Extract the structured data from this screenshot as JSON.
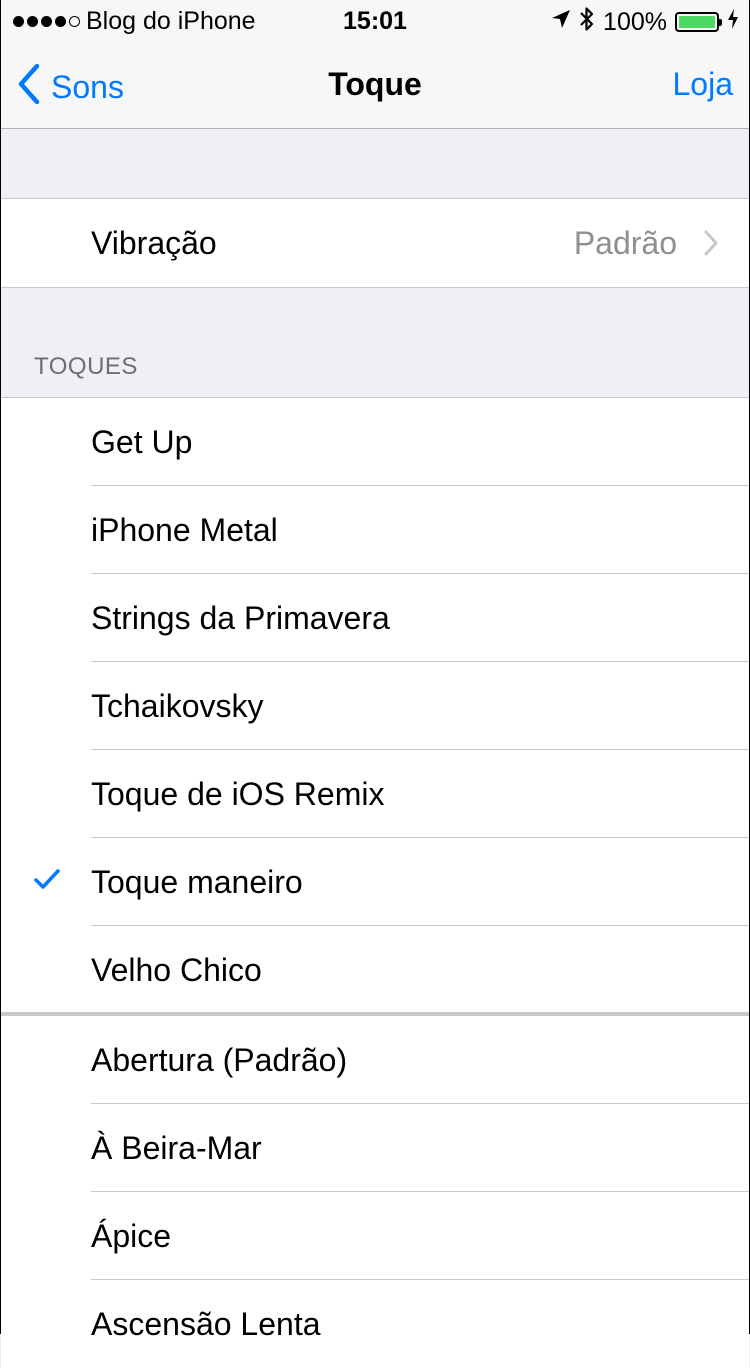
{
  "status_bar": {
    "carrier": "Blog do iPhone",
    "time": "15:01",
    "battery_percent": "100%",
    "battery_level": 1.0,
    "signal_bars_filled": 4,
    "signal_bars_total": 5
  },
  "nav": {
    "back_label": "Sons",
    "title": "Toque",
    "right_label": "Loja"
  },
  "vibration": {
    "label": "Vibração",
    "value": "Padrão"
  },
  "section_header": "TOQUES",
  "tones": [
    {
      "label": "Get Up",
      "selected": false
    },
    {
      "label": "iPhone Metal",
      "selected": false
    },
    {
      "label": "Strings da Primavera",
      "selected": false
    },
    {
      "label": "Tchaikovsky",
      "selected": false
    },
    {
      "label": "Toque de iOS Remix",
      "selected": false
    },
    {
      "label": "Toque maneiro",
      "selected": true
    },
    {
      "label": "Velho Chico",
      "selected": false
    }
  ],
  "system_tones": [
    {
      "label": "Abertura (Padrão)"
    },
    {
      "label": "À Beira-Mar"
    },
    {
      "label": "Ápice"
    },
    {
      "label": "Ascensão Lenta"
    }
  ],
  "colors": {
    "accent": "#007aff",
    "battery": "#4cd964",
    "background": "#efeff4"
  }
}
